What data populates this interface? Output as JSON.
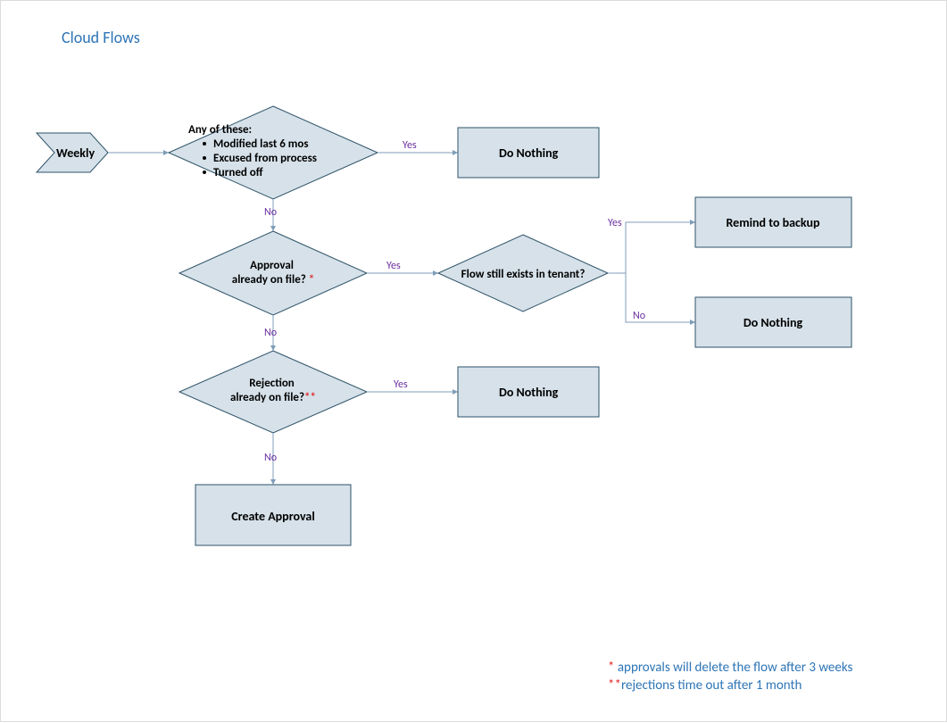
{
  "title": "Cloud Flows",
  "nodes": {
    "weekly": "Weekly",
    "anyOfThese": {
      "heading": "Any of these:",
      "items": [
        "Modified last 6 mos",
        "Excused from process",
        "Turned off"
      ]
    },
    "doNothing1": "Do Nothing",
    "approvalOnFile": {
      "text": "Approval already on file?",
      "note": "*"
    },
    "flowExists": "Flow still exists in tenant?",
    "remindBackup": "Remind to backup",
    "doNothing2": "Do Nothing",
    "rejectionOnFile": {
      "text": "Rejection already on file?",
      "note": "**"
    },
    "doNothing3": "Do Nothing",
    "createApproval": "Create Approval"
  },
  "edges": {
    "yes": "Yes",
    "no": "No"
  },
  "footnotes": {
    "f1prefix": "* ",
    "f1text": "approvals will delete the flow after 3 weeks",
    "f2prefix": "**",
    "f2text": "rejections time out after 1 month"
  },
  "chart_data": {
    "type": "flowchart",
    "title": "Cloud Flows",
    "nodes": [
      {
        "id": "weekly",
        "type": "start-chevron",
        "label": "Weekly"
      },
      {
        "id": "cond_any",
        "type": "decision",
        "label": "Any of these: Modified last 6 mos / Excused from process / Turned off"
      },
      {
        "id": "dn1",
        "type": "process",
        "label": "Do Nothing"
      },
      {
        "id": "cond_approval",
        "type": "decision",
        "label": "Approval already on file? *"
      },
      {
        "id": "cond_exists",
        "type": "decision",
        "label": "Flow still exists in tenant?"
      },
      {
        "id": "remind",
        "type": "process",
        "label": "Remind to backup"
      },
      {
        "id": "dn2",
        "type": "process",
        "label": "Do Nothing"
      },
      {
        "id": "cond_rejection",
        "type": "decision",
        "label": "Rejection already on file? **"
      },
      {
        "id": "dn3",
        "type": "process",
        "label": "Do Nothing"
      },
      {
        "id": "create",
        "type": "process",
        "label": "Create Approval"
      }
    ],
    "edges": [
      {
        "from": "weekly",
        "to": "cond_any",
        "label": ""
      },
      {
        "from": "cond_any",
        "to": "dn1",
        "label": "Yes"
      },
      {
        "from": "cond_any",
        "to": "cond_approval",
        "label": "No"
      },
      {
        "from": "cond_approval",
        "to": "cond_exists",
        "label": "Yes"
      },
      {
        "from": "cond_exists",
        "to": "remind",
        "label": "Yes"
      },
      {
        "from": "cond_exists",
        "to": "dn2",
        "label": "No"
      },
      {
        "from": "cond_approval",
        "to": "cond_rejection",
        "label": "No"
      },
      {
        "from": "cond_rejection",
        "to": "dn3",
        "label": "Yes"
      },
      {
        "from": "cond_rejection",
        "to": "create",
        "label": "No"
      }
    ],
    "footnotes": [
      "* approvals will delete the flow after 3 weeks",
      "** rejections time out after 1 month"
    ]
  }
}
